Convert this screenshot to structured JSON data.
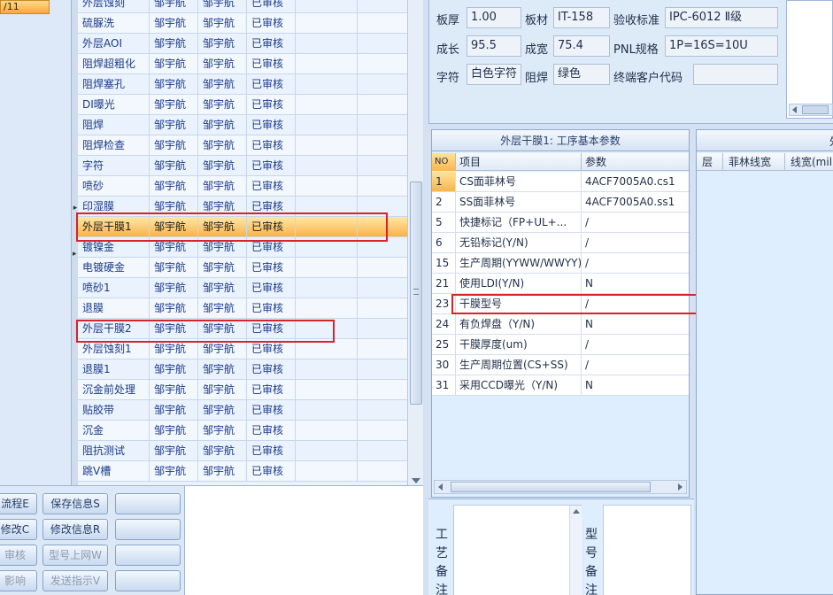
{
  "left_strip": {
    "selected_label": "/11"
  },
  "process_grid": {
    "rows": [
      {
        "name": "外层蚀刻",
        "col2": "邹宇航",
        "col3": "邹宇航",
        "status": "已审核"
      },
      {
        "name": "硫脲洗",
        "col2": "邹宇航",
        "col3": "邹宇航",
        "status": "已审核"
      },
      {
        "name": "外层AOI",
        "col2": "邹宇航",
        "col3": "邹宇航",
        "status": "已审核"
      },
      {
        "name": "阻焊超粗化",
        "col2": "邹宇航",
        "col3": "邹宇航",
        "status": "已审核"
      },
      {
        "name": "阻焊塞孔",
        "col2": "邹宇航",
        "col3": "邹宇航",
        "status": "已审核"
      },
      {
        "name": "DI曝光",
        "col2": "邹宇航",
        "col3": "邹宇航",
        "status": "已审核"
      },
      {
        "name": "阻焊",
        "col2": "邹宇航",
        "col3": "邹宇航",
        "status": "已审核"
      },
      {
        "name": "阻焊检查",
        "col2": "邹宇航",
        "col3": "邹宇航",
        "status": "已审核"
      },
      {
        "name": "字符",
        "col2": "邹宇航",
        "col3": "邹宇航",
        "status": "已审核"
      },
      {
        "name": "喷砂",
        "col2": "邹宇航",
        "col3": "邹宇航",
        "status": "已审核"
      },
      {
        "name": "印湿膜",
        "col2": "邹宇航",
        "col3": "邹宇航",
        "status": "已审核"
      },
      {
        "name": "外层干膜1",
        "col2": "邹宇航",
        "col3": "邹宇航",
        "status": "已审核",
        "selected": true
      },
      {
        "name": "镀镍金",
        "col2": "邹宇航",
        "col3": "邹宇航",
        "status": "已审核"
      },
      {
        "name": "电镀硬金",
        "col2": "邹宇航",
        "col3": "邹宇航",
        "status": "已审核"
      },
      {
        "name": "喷砂1",
        "col2": "邹宇航",
        "col3": "邹宇航",
        "status": "已审核"
      },
      {
        "name": "退膜",
        "col2": "邹宇航",
        "col3": "邹宇航",
        "status": "已审核"
      },
      {
        "name": "外层干膜2",
        "col2": "邹宇航",
        "col3": "邹宇航",
        "status": "已审核"
      },
      {
        "name": "外层蚀刻1",
        "col2": "邹宇航",
        "col3": "邹宇航",
        "status": "已审核"
      },
      {
        "name": "退膜1",
        "col2": "邹宇航",
        "col3": "邹宇航",
        "status": "已审核"
      },
      {
        "name": "沉金前处理",
        "col2": "邹宇航",
        "col3": "邹宇航",
        "status": "已审核"
      },
      {
        "name": "贴胶带",
        "col2": "邹宇航",
        "col3": "邹宇航",
        "status": "已审核"
      },
      {
        "name": "沉金",
        "col2": "邹宇航",
        "col3": "邹宇航",
        "status": "已审核"
      },
      {
        "name": "阻抗测试",
        "col2": "邹宇航",
        "col3": "邹宇航",
        "status": "已审核"
      },
      {
        "name": "跳V槽",
        "col2": "邹宇航",
        "col3": "邹宇航",
        "status": "已审核"
      }
    ]
  },
  "buttons": {
    "left_col": [
      "流程E",
      "修改C",
      "审核",
      "影响"
    ],
    "right_col": [
      "保存信息S",
      "修改信息R",
      "型号上网W",
      "发送指示V"
    ],
    "extra_col": [
      "",
      "",
      "",
      ""
    ]
  },
  "info": {
    "thickness_label": "板厚",
    "thickness_value": "1.00",
    "material_label": "板材",
    "material_value": "IT-158",
    "standard_label": "验收标准",
    "standard_value": "IPC-6012 Ⅱ级",
    "length_label": "成长",
    "length_value": "95.5",
    "width_label": "成宽",
    "width_value": "75.4",
    "pnl_label": "PNL规格",
    "pnl_value": "1P=16S=10U",
    "char_label": "字符",
    "char_value": "白色字符",
    "mask_label": "阻焊",
    "mask_value": "绿色",
    "customer_code_label": "终端客户代码",
    "customer_code_value": ""
  },
  "params": {
    "title": "外层干膜1: 工序基本参数",
    "header": {
      "no": "NO",
      "item": "项目",
      "value": "参数"
    },
    "rows": [
      {
        "no": "1",
        "item": "CS面菲林号",
        "value": "4ACF7005A0.cs1",
        "selected": true
      },
      {
        "no": "2",
        "item": "SS面菲林号",
        "value": "4ACF7005A0.ss1"
      },
      {
        "no": "5",
        "item": "快捷标记（FP+UL+...",
        "value": "/"
      },
      {
        "no": "6",
        "item": "无铅标记(Y/N)",
        "value": "/"
      },
      {
        "no": "15",
        "item": "生产周期(YYWW/WWYY)",
        "value": "/"
      },
      {
        "no": "21",
        "item": "使用LDI(Y/N)",
        "value": "N"
      },
      {
        "no": "23",
        "item": "干膜型号",
        "value": "/"
      },
      {
        "no": "24",
        "item": "有负焊盘（Y/N)",
        "value": "N"
      },
      {
        "no": "25",
        "item": "干膜厚度(um)",
        "value": "/"
      },
      {
        "no": "30",
        "item": "生产周期位置(CS+SS)",
        "value": "/"
      },
      {
        "no": "31",
        "item": "采用CCD曝光（Y/N)",
        "value": "N"
      }
    ]
  },
  "layers": {
    "title_fragment": "外",
    "header": {
      "layer": "层",
      "film_width": "菲林线宽",
      "line_width": "线宽(mil"
    }
  },
  "remarks": {
    "process_label": "工艺备注",
    "model_label": "型号备注"
  }
}
